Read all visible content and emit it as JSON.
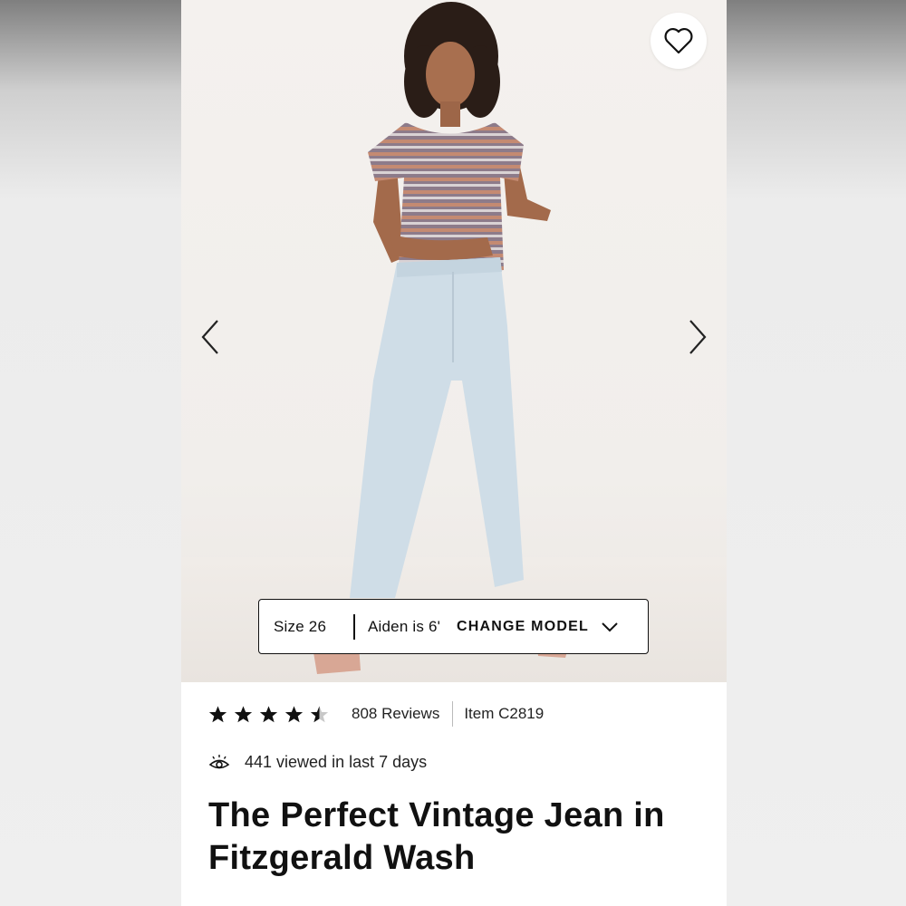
{
  "colors": {
    "accent": "#111111",
    "star_empty": "#c8c8c8"
  },
  "favorite": {
    "icon": "heart-outline-icon"
  },
  "carousel": {
    "prev_icon": "chevron-left-icon",
    "next_icon": "chevron-right-icon"
  },
  "model": {
    "size": "Size 26",
    "name": "Aiden is 6'",
    "change_label": "CHANGE MODEL",
    "dropdown_icon": "chevron-down-icon"
  },
  "rating": {
    "stars": 4.5,
    "reviews": "808 Reviews",
    "item": "Item C2819"
  },
  "views": {
    "icon": "eye-icon",
    "text": "441 viewed in last 7 days"
  },
  "product": {
    "title_line1": "The Perfect Vintage Jean in",
    "title_line2": "Fitzgerald Wash"
  }
}
